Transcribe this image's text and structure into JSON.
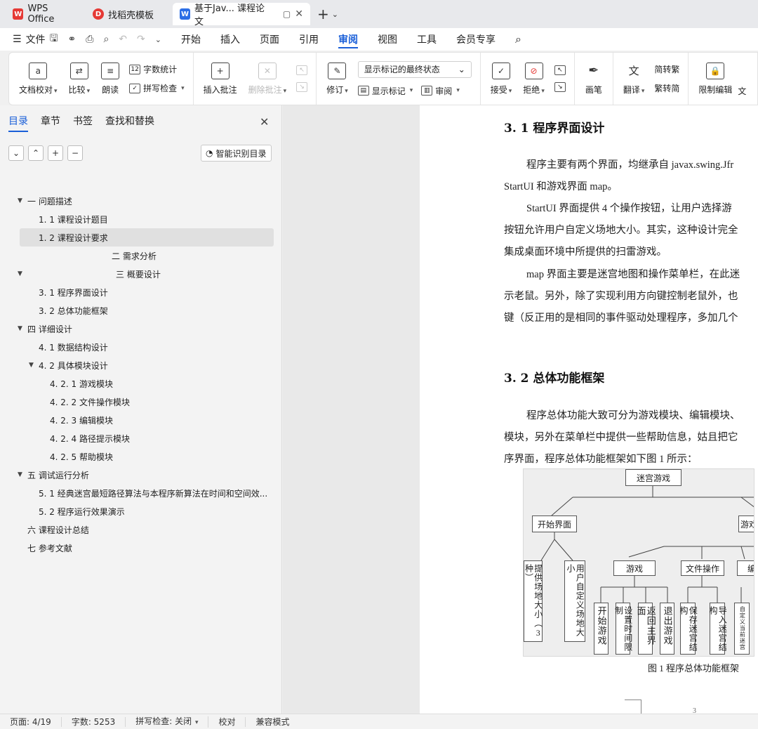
{
  "tabs": [
    {
      "label": "WPS Office",
      "icon": "wps-logo-icon",
      "color": "#e53935"
    },
    {
      "label": "找稻壳模板",
      "icon": "docer-icon",
      "color": "#e53935"
    },
    {
      "label": "基于Jav... 课程论文",
      "icon": "writer-doc-icon",
      "color": "#2b6ee6",
      "active": true
    }
  ],
  "menu": {
    "file": "文件",
    "items": [
      "开始",
      "插入",
      "页面",
      "引用",
      "审阅",
      "视图",
      "工具",
      "会员专享"
    ],
    "active": "审阅"
  },
  "ribbon": {
    "doc_check": "文档校对",
    "compare": "比较",
    "read_aloud": "朗读",
    "word_count": "字数统计",
    "spell_check": "拼写检查",
    "insert_comment": "插入批注",
    "delete_comment": "删除批注",
    "revise": "修订",
    "markup_state": "显示标记的最终状态",
    "show_markup": "显示标记",
    "review": "审阅",
    "accept": "接受",
    "reject": "拒绝",
    "pen": "画笔",
    "translate": "翻译",
    "to_traditional": "简转繁",
    "to_simplified": "繁转简",
    "restrict_edit": "限制编辑",
    "trailing": "文"
  },
  "panel": {
    "tabs": [
      "目录",
      "章节",
      "书签",
      "查找和替换"
    ],
    "active_tab": "目录",
    "smart_toc": "智能识别目录",
    "toc": [
      {
        "label": "一  问题描述",
        "level": 1,
        "expanded": true
      },
      {
        "label": "1. 1  课程设计题目",
        "level": 2
      },
      {
        "label": "1. 2  课程设计要求",
        "level": 2,
        "selected": true
      },
      {
        "label": "二  需求分析",
        "level": 9
      },
      {
        "label": "三  概要设计",
        "level": 10,
        "expanded": true
      },
      {
        "label": "3. 1  程序界面设计",
        "level": 2
      },
      {
        "label": "3. 2  总体功能框架",
        "level": 2
      },
      {
        "label": "四  详细设计",
        "level": 1,
        "expanded": true
      },
      {
        "label": "4. 1  数据结构设计",
        "level": 2
      },
      {
        "label": "4. 2  具体模块设计",
        "level": 2,
        "expanded": true
      },
      {
        "label": "4. 2. 1    游戏模块",
        "level": 3
      },
      {
        "label": "4. 2. 2    文件操作模块",
        "level": 3
      },
      {
        "label": "4. 2. 3    编辑模块",
        "level": 3
      },
      {
        "label": "4. 2. 4    路径提示模块",
        "level": 3
      },
      {
        "label": "4. 2. 5    帮助模块",
        "level": 3
      },
      {
        "label": "五  调试运行分析",
        "level": 1,
        "expanded": true
      },
      {
        "label": "5. 1 经典迷宫最短路径算法与本程序新算法在时间和空间效...",
        "level": 2
      },
      {
        "label": "5. 2  程序运行效果演示",
        "level": 2
      },
      {
        "label": "六  课程设计总结",
        "level": 1
      },
      {
        "label": "七  参考文献",
        "level": 1
      }
    ]
  },
  "document": {
    "h31": "3. 1  程序界面设计",
    "p1a": "程序主要有两个界面，均继承自 javax.swing.Jfr",
    "p1b": "StartUI 和游戏界面 map。",
    "p2a": "StartUI 界面提供 4 个操作按钮，让用户选择游",
    "p2b": "按钮允许用户自定义场地大小。其实，这种设计完全",
    "p2c": "集成桌面环境中所提供的扫雷游戏。",
    "p3a": "map 界面主要是迷宫地图和操作菜单栏，在此迷",
    "p3b": "示老鼠。另外，除了实现利用方向键控制老鼠外，也",
    "p3c": "键（反正用的是相同的事件驱动处理程序，多加几个",
    "h32": "3. 2  总体功能框架",
    "p4a": "程序总体功能大致可分为游戏模块、编辑模块、",
    "p4b": "模块，另外在菜单栏中提供一些帮助信息，姑且把它",
    "p4c": "序界面，程序总体功能框架如下图 1 所示：",
    "figure": {
      "root": "迷宫游戏",
      "start_ui": "开始界面",
      "game_ui": "游戏",
      "game": "游戏",
      "file_ops": "文件操作",
      "edit": "编",
      "v_size3": "提供场地大小（3种）",
      "v_custom": "用户自定义场地大小",
      "v_start": "开始游戏",
      "v_time": "设置时间限制",
      "v_back": "返回主界面",
      "v_exit": "退出游戏",
      "v_save": "保存迷宫结构",
      "v_import": "导入迷宫结构",
      "v_custom_maze": "自定义当前迷宫"
    },
    "caption": "图 1  程序总体功能框架",
    "page_number": "3"
  },
  "status": {
    "page": "页面: 4/19",
    "words": "字数: 5253",
    "spell": "拼写检查: 关闭",
    "proof": "校对",
    "compat": "兼容模式"
  },
  "colors": {
    "accent": "#1a5fd8",
    "wps_red": "#e53935"
  }
}
